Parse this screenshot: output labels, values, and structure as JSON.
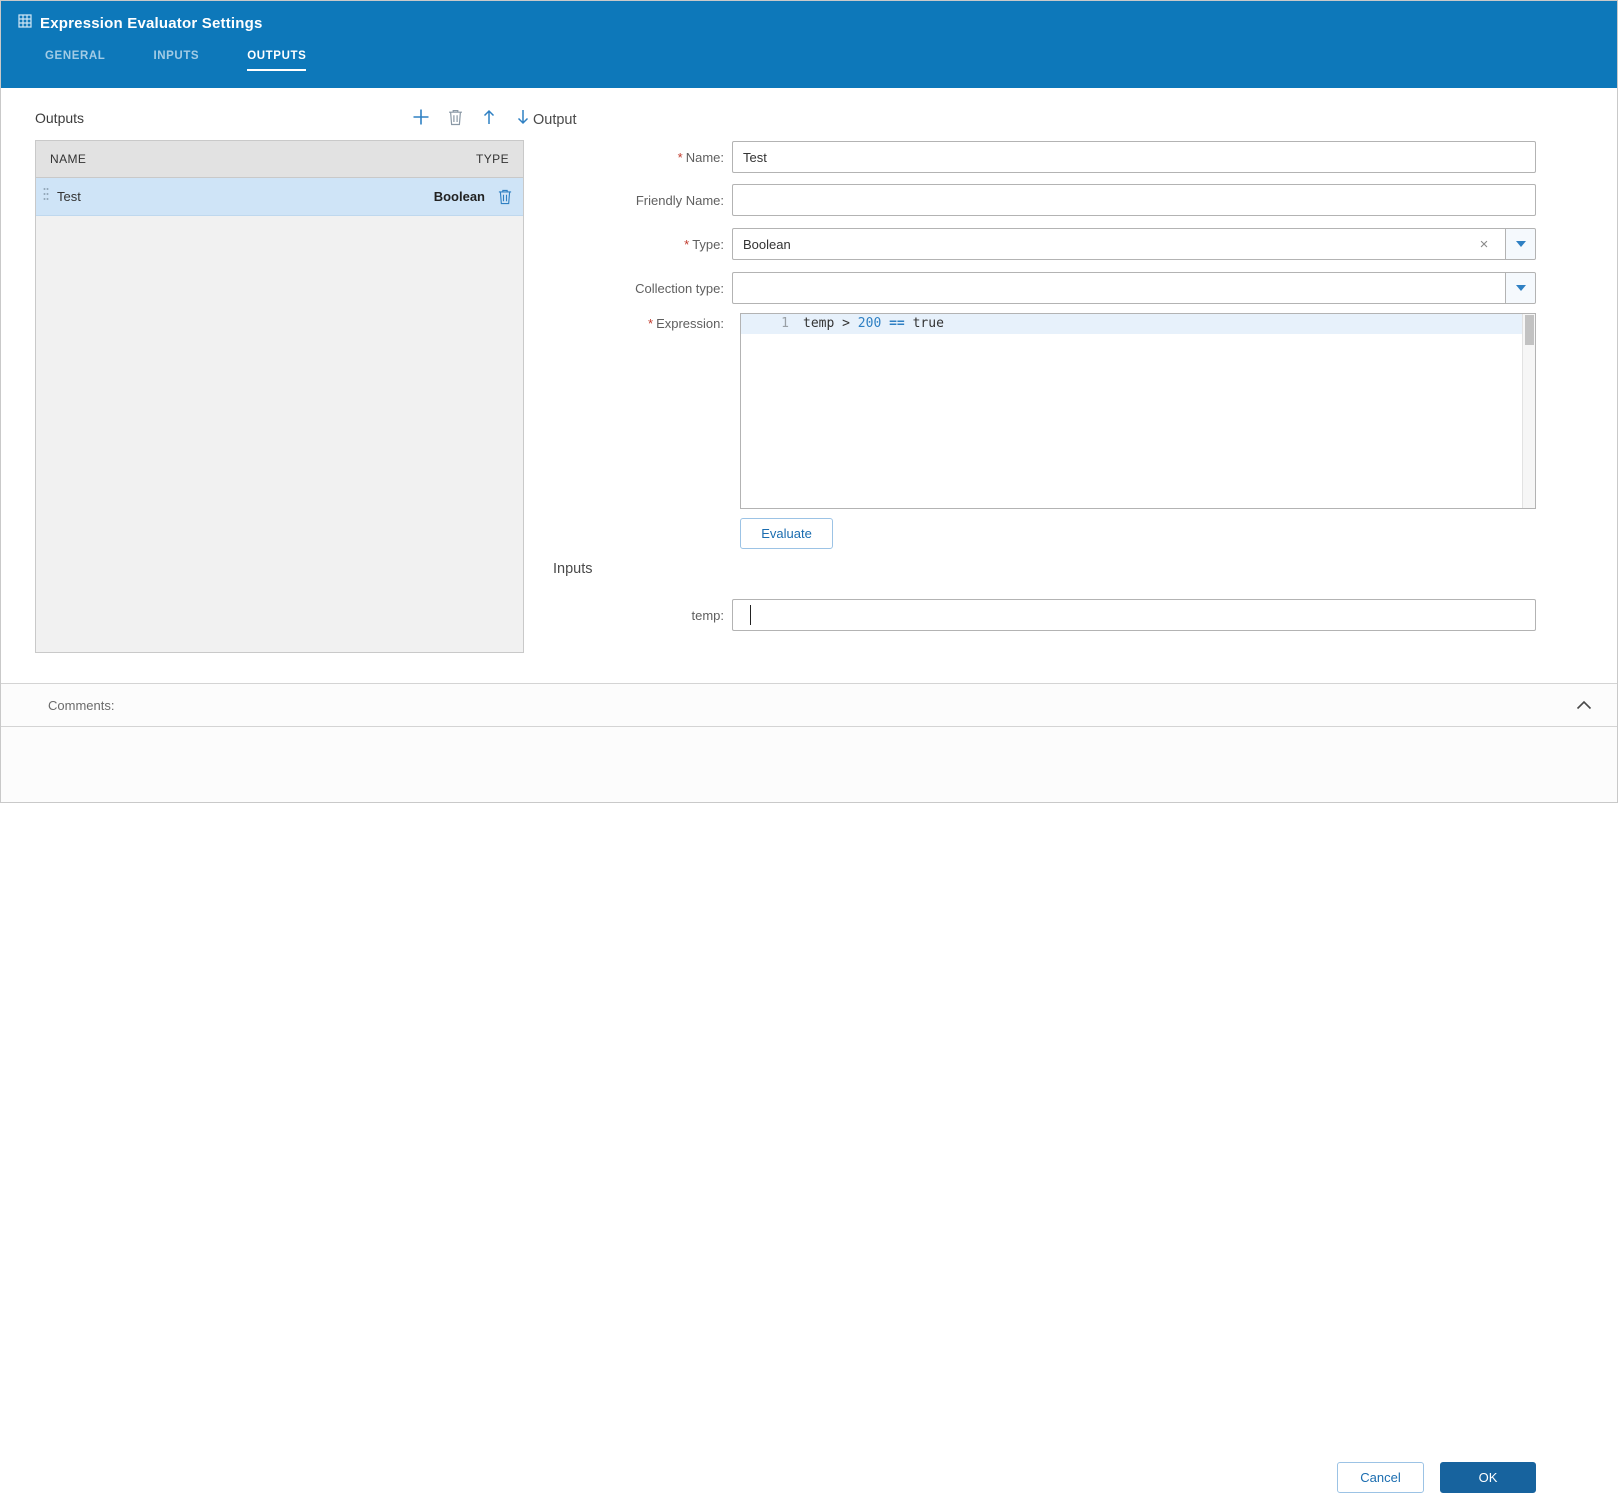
{
  "colors": {
    "header_bg": "#0d78ba",
    "accent": "#2f80c3",
    "accent_dark": "#1b6db0",
    "ok_bg": "#17639e",
    "selection": "#cfe4f7",
    "required": "#c0392b"
  },
  "required_marker": "*",
  "window": {
    "title": "Expression Evaluator Settings",
    "tabs": [
      {
        "label": "GENERAL"
      },
      {
        "label": "INPUTS"
      },
      {
        "label": "OUTPUTS"
      }
    ],
    "active_tab": "OUTPUTS"
  },
  "outputs_panel": {
    "title": "Outputs",
    "columns": {
      "name": "NAME",
      "type": "TYPE"
    },
    "rows": [
      {
        "name": "Test",
        "type": "Boolean",
        "selected": true
      }
    ]
  },
  "output_form": {
    "title": "Output",
    "fields": {
      "name": {
        "label": "Name:",
        "required": true,
        "value": "Test"
      },
      "friendly_name": {
        "label": "Friendly Name:",
        "required": false,
        "value": ""
      },
      "type": {
        "label": "Type:",
        "required": true,
        "value": "Boolean"
      },
      "collection_type": {
        "label": "Collection type:",
        "required": false,
        "value": ""
      },
      "expression": {
        "label": "Expression:",
        "required": true
      }
    },
    "expression_editor": {
      "line_number": "1",
      "code": "temp > 200 == true",
      "tokens": [
        {
          "text": "temp ",
          "type": "plain"
        },
        {
          "text": "> ",
          "type": "plain"
        },
        {
          "text": "200 ",
          "type": "number"
        },
        {
          "text": "== ",
          "type": "operator"
        },
        {
          "text": "true",
          "type": "plain"
        }
      ]
    },
    "evaluate_button": "Evaluate"
  },
  "inputs_section": {
    "title": "Inputs",
    "fields": [
      {
        "label": "temp:",
        "value": ""
      }
    ]
  },
  "comments": {
    "label": "Comments:"
  },
  "footer": {
    "cancel_button": "Cancel",
    "ok_button": "OK"
  }
}
